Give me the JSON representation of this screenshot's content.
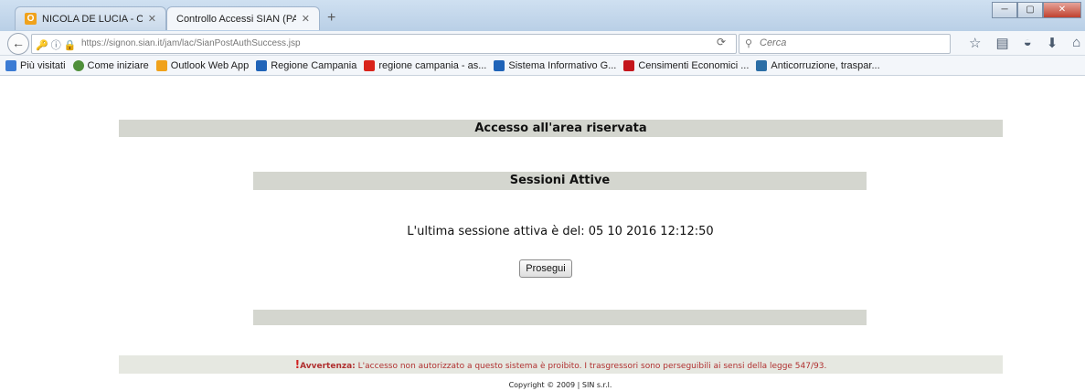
{
  "browser": {
    "tabs": [
      {
        "label": "NICOLA DE LUCIA - Outloo...",
        "icon": "outlook-icon"
      },
      {
        "label": "Controllo Accessi SIAN (PAP)",
        "icon": "none"
      }
    ],
    "new_tab": "+",
    "url": "https://signon.sian.it/jam/lac/SianPostAuthSuccess.jsp",
    "search_placeholder": "Cerca",
    "bookmarks": [
      {
        "label": "Più visitati",
        "color": "#3b7bd4"
      },
      {
        "label": "Come iniziare",
        "color": "#4f8f3a"
      },
      {
        "label": "Outlook Web App",
        "color": "#f0a21b"
      },
      {
        "label": "Regione Campania",
        "color": "#1f63b8"
      },
      {
        "label": "regione campania - as...",
        "color": "#d9241b"
      },
      {
        "label": "Sistema Informativo G...",
        "color": "#1f63b8"
      },
      {
        "label": "Censimenti Economici ...",
        "color": "#c4161c"
      },
      {
        "label": "Anticorruzione, traspar...",
        "color": "#2b6ea6"
      }
    ]
  },
  "page": {
    "header_title": "Accesso all'area riservata",
    "sessions_title": "Sessioni Attive",
    "last_session_text": "L'ultima sessione attiva è del: 05 10 2016 12:12:50",
    "continue_button": "Prosegui",
    "warning_label": "Avvertenza:",
    "warning_text": "L'accesso non autorizzato a questo sistema è proibito. I trasgressori sono perseguibili ai sensi della legge 547/93.",
    "copyright": "Copyright © 2009 | SIN s.r.l."
  },
  "colors": {
    "bar": "#d4d6cf",
    "warning": "#b03030"
  }
}
